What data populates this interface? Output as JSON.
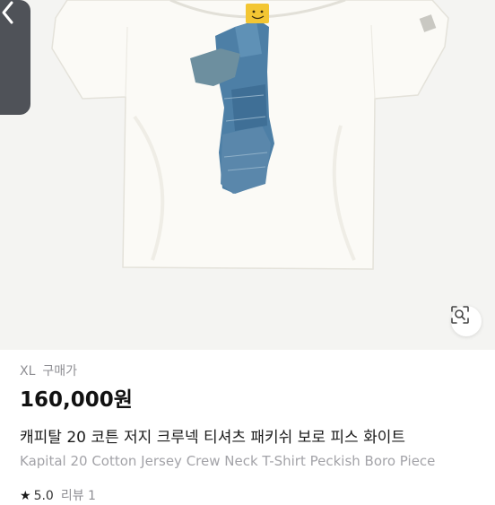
{
  "listing": {
    "size_label": "XL",
    "purchase_price_label": "구매가",
    "price": "160,000원",
    "title_ko": "캐피탈 20 코튼 저지 크루넥 티셔츠 패키쉬 보로 피스 화이트",
    "title_en": "Kapital 20 Cotton Jersey Crew Neck T-Shirt Peckish Boro Piece",
    "rating": "5.0",
    "reviews_label": "리뷰 1"
  },
  "icons": {
    "back": "chevron-left-icon",
    "lens": "image-search-icon",
    "star": "star-icon"
  },
  "colors": {
    "shirt": "#fbfaf6",
    "denim": "#4d7fa6",
    "back_tab": "#4f5258",
    "price_text": "#111111",
    "muted_text": "#8e8e93"
  }
}
